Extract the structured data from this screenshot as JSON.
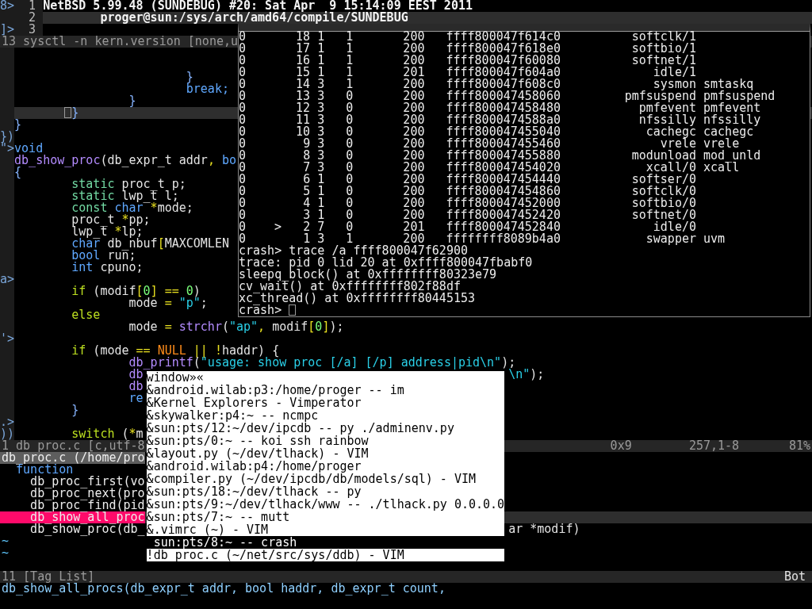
{
  "top_pane": {
    "lines": [
      {
        "sign": "8>",
        "number": "1",
        "text": "NetBSD 5.99.48 (SUNDEBUG) #20: Sat Apr  9 15:14:09 EEST 2011"
      },
      {
        "number": "2",
        "text": "\tproger@sun:/sys/arch/amd64/compile/SUNDEBUG",
        "cursor_line": true
      },
      {
        "sign": "]>",
        "number": "3"
      }
    ],
    "status": "13 sysctl -n kern.version [none,u"
  },
  "code_pane": {
    "lines": [
      {
        "kind": "blank"
      },
      {
        "kind": "blank"
      },
      {
        "kind": "code",
        "tokens": [
          {
            "kind": "brace",
            "text": "\t\t\t}"
          }
        ]
      },
      {
        "kind": "code",
        "tokens": [
          {
            "kind": "type",
            "text": "\t\t\tbreak;"
          }
        ]
      },
      {
        "kind": "code",
        "tokens": [
          {
            "kind": "brace",
            "text": "\t\t}"
          }
        ]
      },
      {
        "kind": "code",
        "cursor_line": true,
        "tokens": [
          {
            "kind": "brace",
            "text": "\t}"
          }
        ]
      },
      {
        "kind": "code",
        "tokens": [
          {
            "kind": "brace",
            "text": "}"
          }
        ]
      },
      {
        "kind": "blank",
        "sign": "})"
      },
      {
        "kind": "code",
        "sign": "\">",
        "tokens": [
          {
            "kind": "type",
            "text": "void"
          }
        ]
      },
      {
        "kind": "code",
        "tokens": [
          {
            "kind": "function",
            "text": "db_show_proc"
          },
          {
            "kind": "plain",
            "text": "(db_expr_t addr"
          },
          {
            "kind": "operator",
            "text": ","
          },
          {
            "kind": "type",
            "text": " bo"
          }
        ]
      },
      {
        "kind": "code",
        "tokens": [
          {
            "kind": "brace",
            "text": "{"
          }
        ]
      },
      {
        "kind": "code",
        "tokens": [
          {
            "kind": "storage",
            "text": "\tstatic"
          },
          {
            "kind": "plain",
            "text": " proc_t p;"
          }
        ]
      },
      {
        "kind": "code",
        "tokens": [
          {
            "kind": "storage",
            "text": "\tstatic"
          },
          {
            "kind": "plain",
            "text": " lwp_t l;"
          }
        ]
      },
      {
        "kind": "code",
        "tokens": [
          {
            "kind": "storage",
            "text": "\tconst"
          },
          {
            "kind": "type",
            "text": " char"
          },
          {
            "kind": "operator",
            "text": " *"
          },
          {
            "kind": "plain",
            "text": "mode;"
          }
        ]
      },
      {
        "kind": "code",
        "tokens": [
          {
            "kind": "plain",
            "text": "\tproc_t "
          },
          {
            "kind": "operator",
            "text": "*"
          },
          {
            "kind": "plain",
            "text": "pp;"
          }
        ]
      },
      {
        "kind": "code",
        "tokens": [
          {
            "kind": "plain",
            "text": "\tlwp_t "
          },
          {
            "kind": "operator",
            "text": "*"
          },
          {
            "kind": "plain",
            "text": "lp;"
          }
        ]
      },
      {
        "kind": "code",
        "tokens": [
          {
            "kind": "type",
            "text": "\tchar"
          },
          {
            "kind": "plain",
            "text": " db_nbuf"
          },
          {
            "kind": "operator",
            "text": "["
          },
          {
            "kind": "plain",
            "text": "MAXCOMLEN"
          }
        ]
      },
      {
        "kind": "code",
        "tokens": [
          {
            "kind": "type",
            "text": "\tbool"
          },
          {
            "kind": "plain",
            "text": " run;"
          }
        ]
      },
      {
        "kind": "code",
        "tokens": [
          {
            "kind": "type",
            "text": "\tint"
          },
          {
            "kind": "plain",
            "text": " cpuno;"
          }
        ]
      },
      {
        "kind": "blank",
        "sign": "a>"
      },
      {
        "kind": "code",
        "tokens": [
          {
            "kind": "keyword",
            "text": "\tif"
          },
          {
            "kind": "plain",
            "text": " (modif"
          },
          {
            "kind": "operator",
            "text": "["
          },
          {
            "kind": "number",
            "text": "0"
          },
          {
            "kind": "operator",
            "text": "]"
          },
          {
            "kind": "operator",
            "text": " =="
          },
          {
            "kind": "number",
            "text": " 0"
          },
          {
            "kind": "plain",
            "text": ")"
          }
        ]
      },
      {
        "kind": "code",
        "tokens": [
          {
            "kind": "plain",
            "text": "\t\tmode "
          },
          {
            "kind": "operator",
            "text": "="
          },
          {
            "kind": "string",
            "text": " \"p\""
          },
          {
            "kind": "plain",
            "text": ";"
          }
        ]
      },
      {
        "kind": "code",
        "tokens": [
          {
            "kind": "keyword",
            "text": "\telse"
          }
        ]
      },
      {
        "kind": "code",
        "tokens": [
          {
            "kind": "plain",
            "text": "\t\tmode "
          },
          {
            "kind": "operator",
            "text": "="
          },
          {
            "kind": "function",
            "text": " strchr"
          },
          {
            "kind": "plain",
            "text": "("
          },
          {
            "kind": "string",
            "text": "\"ap\""
          },
          {
            "kind": "operator",
            "text": ","
          },
          {
            "kind": "plain",
            "text": " modif"
          },
          {
            "kind": "operator",
            "text": "["
          },
          {
            "kind": "number",
            "text": "0"
          },
          {
            "kind": "operator",
            "text": "]"
          },
          {
            "kind": "plain",
            "text": ");"
          }
        ]
      },
      {
        "kind": "blank",
        "sign": "'>"
      },
      {
        "kind": "code",
        "tokens": [
          {
            "kind": "keyword",
            "text": "\tif"
          },
          {
            "kind": "plain",
            "text": " (mode "
          },
          {
            "kind": "operator",
            "text": "=="
          },
          {
            "kind": "constant",
            "text": " NULL"
          },
          {
            "kind": "operator",
            "text": " ||"
          },
          {
            "kind": "operator",
            "text": " !"
          },
          {
            "kind": "plain",
            "text": "haddr) {"
          }
        ]
      },
      {
        "kind": "code",
        "tokens": [
          {
            "kind": "function",
            "text": "\t\tdb_printf"
          },
          {
            "kind": "plain",
            "text": "("
          },
          {
            "kind": "string",
            "text": "\"usage: show proc [/a] [/p] address|pid\\n\""
          },
          {
            "kind": "plain",
            "text": ");"
          }
        ]
      },
      {
        "kind": "code",
        "tokens": [
          {
            "kind": "function",
            "text": "\t\tdb"
          }
        ],
        "after": [
          {
            "kind": "string",
            "text": "\\n\""
          },
          {
            "kind": "plain",
            "text": ");"
          }
        ]
      },
      {
        "kind": "code",
        "tokens": [
          {
            "kind": "function",
            "text": "\t\tdb"
          }
        ]
      },
      {
        "kind": "code",
        "tokens": [
          {
            "kind": "type",
            "text": "\t\tre"
          }
        ]
      },
      {
        "kind": "code",
        "tokens": [
          {
            "kind": "brace",
            "text": "\t}"
          }
        ]
      },
      {
        "kind": "blank",
        "sign": ".>"
      },
      {
        "kind": "code",
        "sign": "))",
        "tokens": [
          {
            "kind": "keyword",
            "text": "\tswitch"
          },
          {
            "kind": "plain",
            "text": " ("
          },
          {
            "kind": "operator",
            "text": "*"
          },
          {
            "kind": "plain",
            "text": "m"
          }
        ]
      }
    ],
    "status": {
      "file": "1 db_proc.c [c,utf-8",
      "column_2": "0x9",
      "position": "257,1-8",
      "percent": "81%"
    }
  },
  "tag_list": {
    "title": "db_proc.c (/home/pro",
    "group": "function",
    "items": [
      {
        "text": "db_proc_first(vo",
        "selected": false
      },
      {
        "text": "db_proc_next(pro",
        "selected": false
      },
      {
        "text": "db_proc_find(pid",
        "selected": false
      },
      {
        "text": "db_show_all_proc",
        "selected": true
      },
      {
        "text": "db_show_proc(db_",
        "after": "ar *modif)",
        "selected": false
      }
    ],
    "filler": [
      "~",
      "~"
    ],
    "status": {
      "left": "11 [Tag List]",
      "right": "Bot"
    }
  },
  "command_line": "db_show_all_procs(db_expr_t addr, bool haddr, db_expr_t count,",
  "crash_window": {
    "rows": [
      {
        "column_1": "0",
        "column_2": "18",
        "column_3": "1",
        "column_4": "1",
        "column_5": "200",
        "column_6": "ffff800047f614c0",
        "column_7": "softclk/1"
      },
      {
        "column_1": "0",
        "column_2": "17",
        "column_3": "1",
        "column_4": "1",
        "column_5": "200",
        "column_6": "ffff800047f618e0",
        "column_7": "softbio/1"
      },
      {
        "column_1": "0",
        "column_2": "16",
        "column_3": "1",
        "column_4": "1",
        "column_5": "200",
        "column_6": "ffff800047f60080",
        "column_7": "softnet/1"
      },
      {
        "column_1": "0",
        "column_2": "15",
        "column_3": "1",
        "column_4": "1",
        "column_5": "201",
        "column_6": "ffff800047f604a0",
        "column_7": "idle/1"
      },
      {
        "column_1": "0",
        "column_2": "14",
        "column_3": "3",
        "column_4": "1",
        "column_5": "200",
        "column_6": "ffff800047f608c0",
        "column_7": "sysmon",
        "column_8": "smtaskq"
      },
      {
        "column_1": "0",
        "column_2": "13",
        "column_3": "3",
        "column_4": "0",
        "column_5": "200",
        "column_6": "ffff800047458060",
        "column_7": "pmfsuspend",
        "column_8": "pmfsuspend"
      },
      {
        "column_1": "0",
        "column_2": "12",
        "column_3": "3",
        "column_4": "0",
        "column_5": "200",
        "column_6": "ffff800047458480",
        "column_7": "pmfevent",
        "column_8": "pmfevent"
      },
      {
        "column_1": "0",
        "column_2": "11",
        "column_3": "3",
        "column_4": "0",
        "column_5": "200",
        "column_6": "ffff8000474588a0",
        "column_7": "nfssilly",
        "column_8": "nfssilly"
      },
      {
        "column_1": "0",
        "column_2": "10",
        "column_3": "3",
        "column_4": "0",
        "column_5": "200",
        "column_6": "ffff800047455040",
        "column_7": "cachegc",
        "column_8": "cachegc"
      },
      {
        "column_1": "0",
        "column_2": "9",
        "column_3": "3",
        "column_4": "0",
        "column_5": "200",
        "column_6": "ffff800047455460",
        "column_7": "vrele",
        "column_8": "vrele"
      },
      {
        "column_1": "0",
        "column_2": "8",
        "column_3": "3",
        "column_4": "0",
        "column_5": "200",
        "column_6": "ffff800047455880",
        "column_7": "modunload",
        "column_8": "mod_unld"
      },
      {
        "column_1": "0",
        "column_2": "7",
        "column_3": "3",
        "column_4": "0",
        "column_5": "200",
        "column_6": "ffff800047454020",
        "column_7": "xcall/0",
        "column_8": "xcall"
      },
      {
        "column_1": "0",
        "column_2": "6",
        "column_3": "1",
        "column_4": "0",
        "column_5": "200",
        "column_6": "ffff800047454440",
        "column_7": "softser/0"
      },
      {
        "column_1": "0",
        "column_2": "5",
        "column_3": "1",
        "column_4": "0",
        "column_5": "200",
        "column_6": "ffff800047454860",
        "column_7": "softclk/0"
      },
      {
        "column_1": "0",
        "column_2": "4",
        "column_3": "1",
        "column_4": "0",
        "column_5": "200",
        "column_6": "ffff800047452000",
        "column_7": "softbio/0"
      },
      {
        "column_1": "0",
        "column_2": "3",
        "column_3": "1",
        "column_4": "0",
        "column_5": "200",
        "column_6": "ffff800047452420",
        "column_7": "softnet/0"
      },
      {
        "column_1": "0",
        "flag": ">",
        "column_2": "2",
        "column_3": "7",
        "column_4": "0",
        "column_5": "201",
        "column_6": "ffff800047452840",
        "column_7": "idle/0"
      },
      {
        "column_1": "0",
        "column_2": "1",
        "column_3": "3",
        "column_4": "1",
        "column_5": "200",
        "column_6": "ffffffff8089b4a0",
        "column_7": "swapper",
        "column_8": "uvm"
      }
    ],
    "output": [
      "crash> trace /a ffff800047f62900",
      "trace: pid 0 lid 20 at 0xffff800047fbabf0",
      "sleepq_block() at 0xffffffff80323e79",
      "cv_wait() at 0xffffffff802f88df",
      "xc_thread() at 0xffffffff80445153"
    ],
    "prompt": "crash>"
  },
  "window_menu": {
    "title": "window»«",
    "items": [
      {
        "label": "&android.wilab:p3:/home/proger -- im",
        "selected": false
      },
      {
        "label": "&Kernel Explorers - Vimperator",
        "selected": false
      },
      {
        "label": "&skywalker:p4:~ -- ncmpc",
        "selected": false
      },
      {
        "label": "&sun:pts/12:~/dev/ipcdb -- py ./adminenv.py",
        "selected": false
      },
      {
        "label": "&sun:pts/0:~ -- koi ssh rainbow",
        "selected": false
      },
      {
        "label": "&layout.py (~/dev/tlhack) - VIM",
        "selected": false
      },
      {
        "label": "&android.wilab:p4:/home/proger",
        "selected": false
      },
      {
        "label": "&compiler.py (~/dev/ipcdb/db/models/sql) - VIM",
        "selected": false
      },
      {
        "label": "&sun:pts/18:~/dev/tlhack -- py",
        "selected": false
      },
      {
        "label": "&sun:pts/9:~/dev/tlhack/www -- ./tlhack.py 0.0.0.0",
        "selected": false
      },
      {
        "label": "&sun:pts/7:~ -- mutt",
        "selected": false
      },
      {
        "label": "&.vimrc (~) - VIM",
        "selected": false
      },
      {
        "label": " sun:pts/8:~ -- crash",
        "selected": true
      },
      {
        "label": "!db_proc.c (~/net/src/sys/ddb) - VIM",
        "selected": false
      }
    ]
  }
}
